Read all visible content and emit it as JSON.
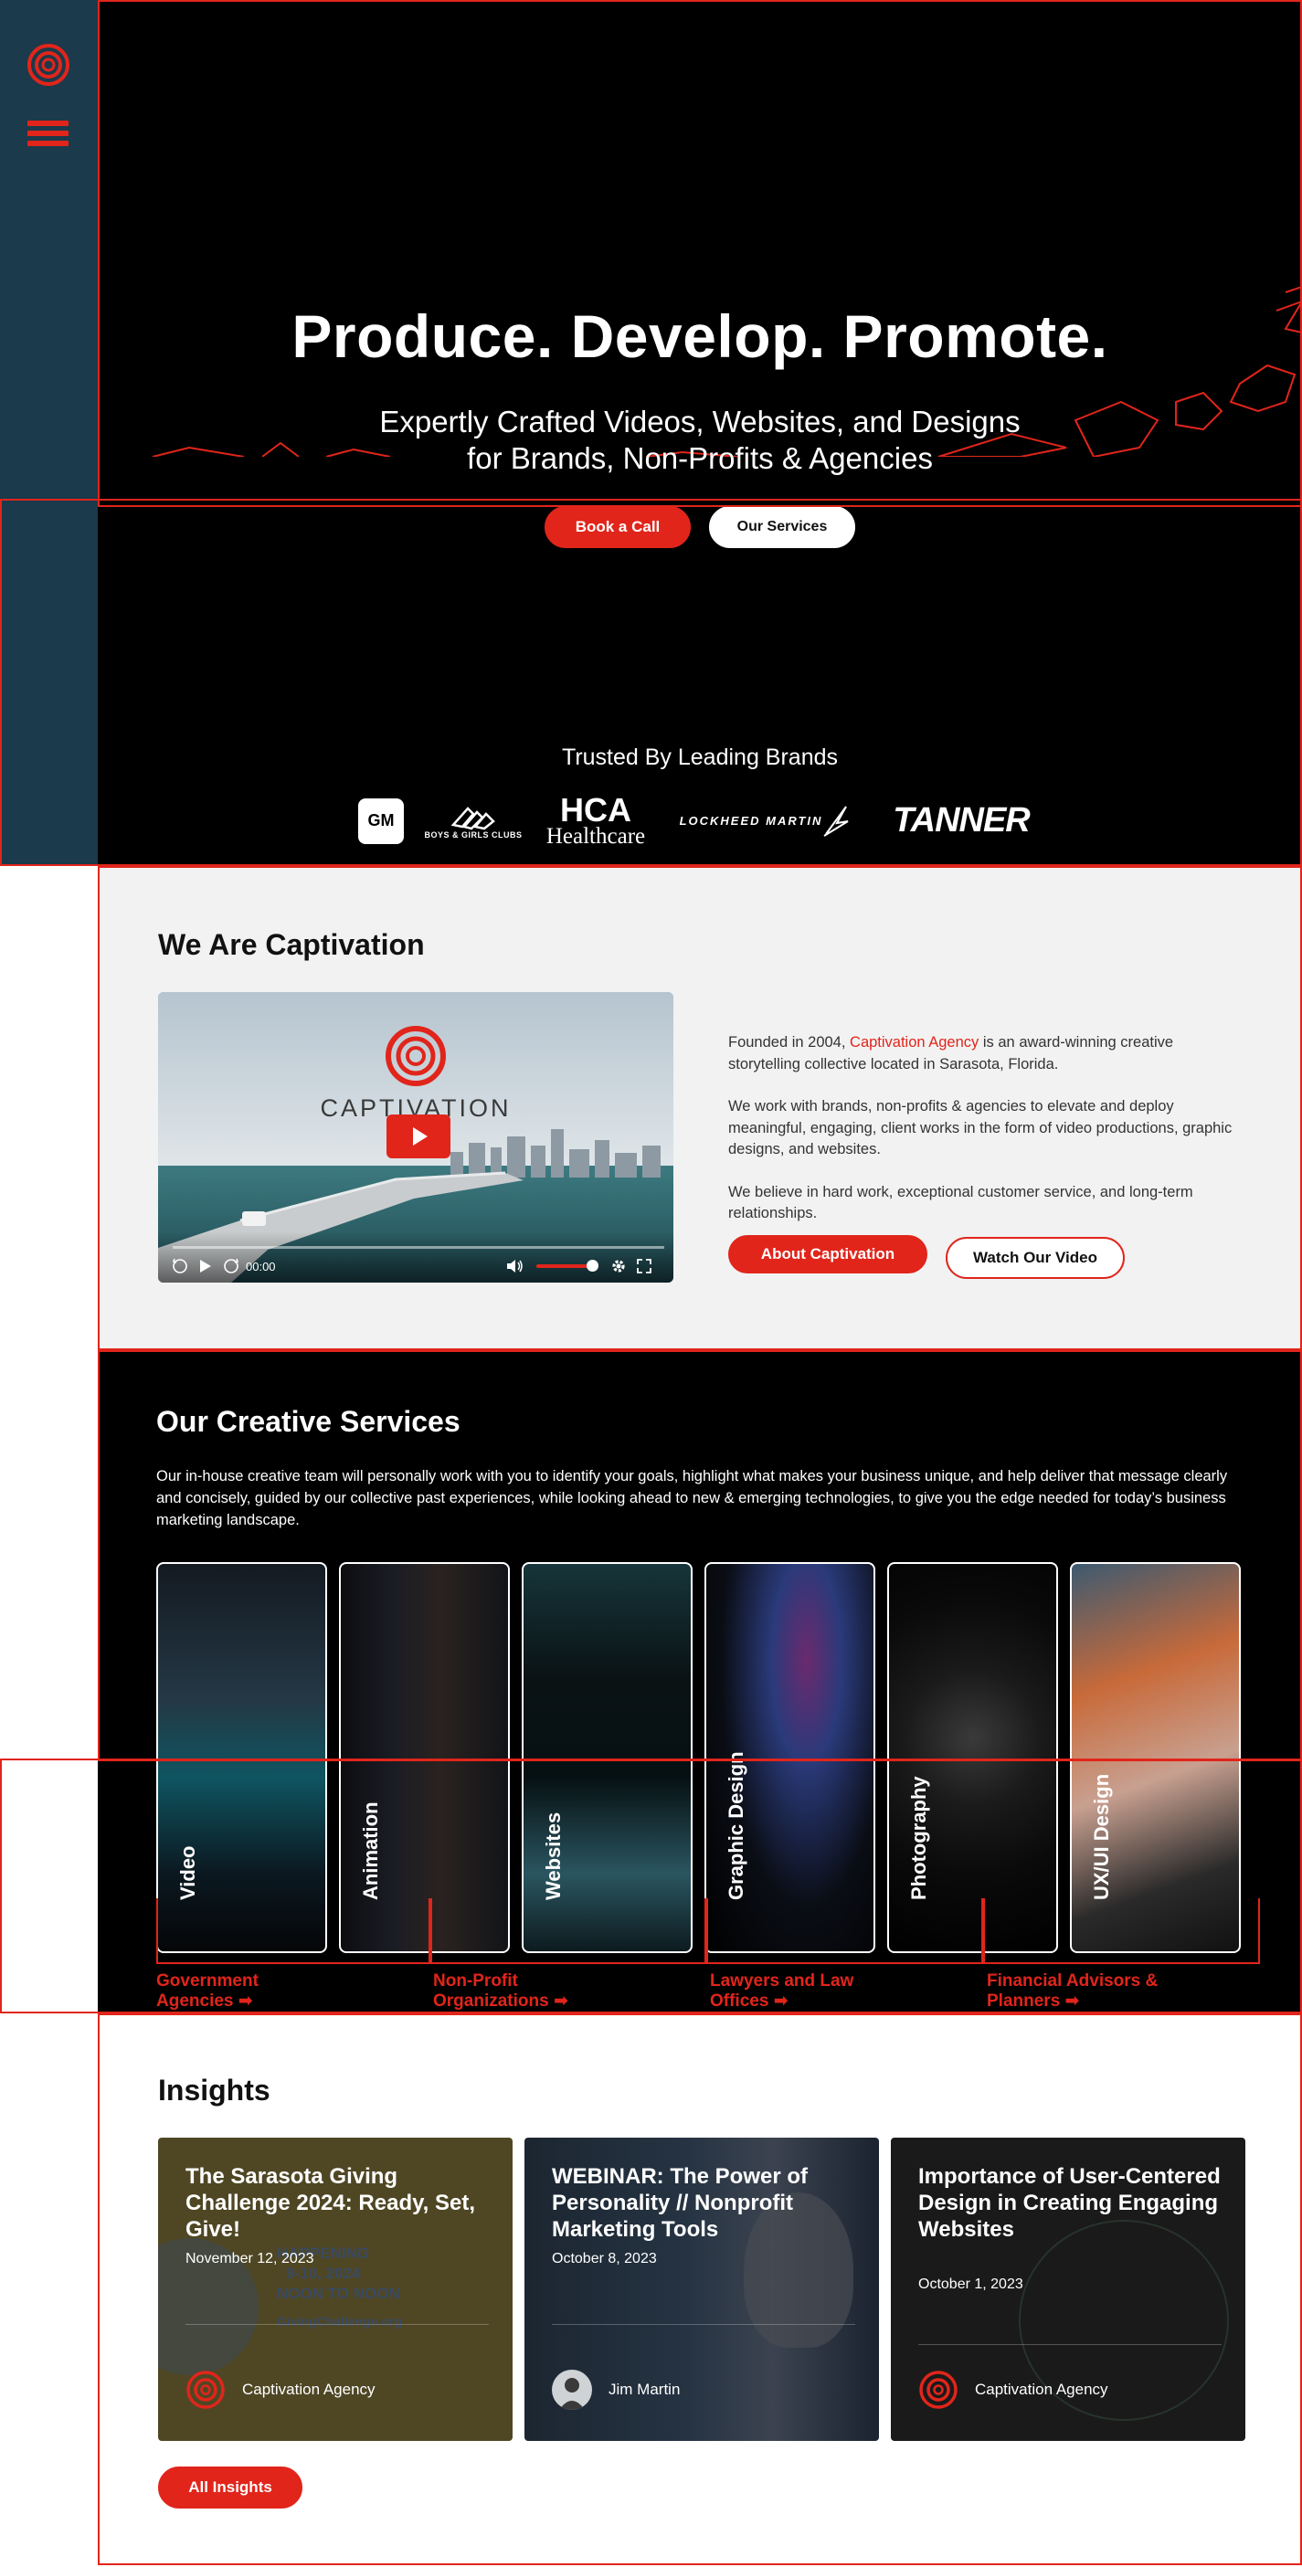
{
  "colors": {
    "accent": "#e1251b",
    "sidebar": "#1b3a4b",
    "dark": "#000000",
    "light_bg": "#f2f2f2"
  },
  "nav": {
    "logo_icon": "captivation-logo-icon",
    "menu_icon": "hamburger-icon"
  },
  "hero": {
    "title": "Produce. Develop. Promote.",
    "subtitle_line1": "Expertly Crafted Videos, Websites, and Designs",
    "subtitle_line2": "for Brands, Non-Profits & Agencies",
    "cta_primary": "Book a Call",
    "cta_secondary": "Our Services",
    "trusted_label": "Trusted By Leading Brands",
    "brands": {
      "gm": "GM",
      "bgc": "BOYS & GIRLS CLUBS",
      "hca_top": "HCA",
      "hca_bottom": "Healthcare",
      "lockheed": "LOCKHEED MARTIN",
      "tanner": "TANNER"
    }
  },
  "about": {
    "title": "We Are Captivation",
    "video": {
      "watermark": "CAPTIVATION",
      "time": "00:00"
    },
    "p1_before": "Founded in 2004, ",
    "p1_link": "Captivation Agency",
    "p1_after": " is an award-winning creative storytelling collective located in Sarasota, Florida.",
    "p2": "We work with brands, non-profits & agencies to elevate and deploy meaningful, engaging, client works in the form of video productions, graphic designs, and websites.",
    "p3": "We believe in hard work, exceptional customer service, and long-term relationships.",
    "btn_about": "About Captivation",
    "btn_video": "Watch Our Video"
  },
  "services": {
    "title": "Our Creative Services",
    "intro": "Our in-house creative team will personally work with you to identify your goals, highlight what makes your business unique, and help deliver that message clearly and concisely, guided by our collective past experiences, while looking ahead to new & emerging technologies, to give you the edge needed for today’s business marketing landscape.",
    "cards": [
      {
        "label": "Video"
      },
      {
        "label": "Animation"
      },
      {
        "label": "Websites"
      },
      {
        "label": "Graphic Design"
      },
      {
        "label": "Photography"
      },
      {
        "label": "UX/UI Design"
      }
    ],
    "industries": [
      {
        "line1": "Government",
        "line2": "Agencies ➡"
      },
      {
        "line1": "Non-Profit",
        "line2": "Organizations ➡"
      },
      {
        "line1": "Lawyers and Law",
        "line2": "Offices ➡"
      },
      {
        "line1": "Financial Advisors &",
        "line2": "Planners ➡"
      }
    ]
  },
  "insights": {
    "title": "Insights",
    "posts": [
      {
        "title": "The Sarasota Giving Challenge 2024: Ready, Set, Give!",
        "date": "November 12, 2023",
        "author": "Captivation Agency"
      },
      {
        "title": "WEBINAR: The Power of Personality // Nonprofit Marketing Tools",
        "date": "October 8, 2023",
        "author": "Jim Martin"
      },
      {
        "title": "Importance of User-Centered Design in Creating Engaging Websites",
        "date": "October 1, 2023",
        "author": "Captivation Agency"
      }
    ],
    "bg_text": {
      "happening": "HAPPENING",
      "dates": "9-10, 2024",
      "noon": "NOON TO NOON",
      "site": "GivingChallenge.org"
    },
    "btn_all": "All Insights"
  }
}
